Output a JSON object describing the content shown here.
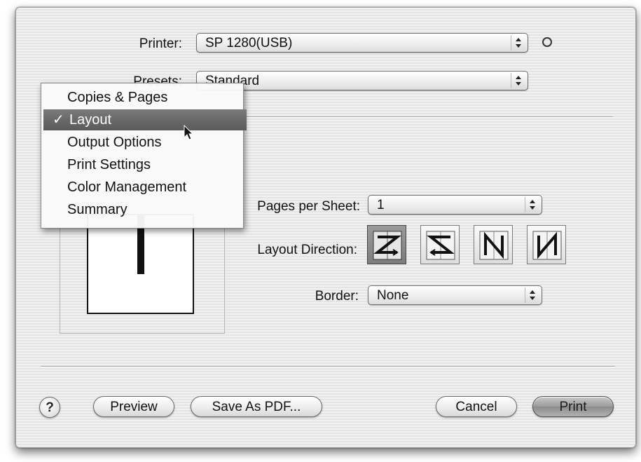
{
  "printer": {
    "label": "Printer:",
    "value": "SP 1280(USB)"
  },
  "presets": {
    "label": "Presets:",
    "value": "Standard"
  },
  "panel_menu": {
    "items": [
      {
        "label": "Copies & Pages",
        "selected": false
      },
      {
        "label": "Layout",
        "selected": true
      },
      {
        "label": "Output Options",
        "selected": false
      },
      {
        "label": "Print Settings",
        "selected": false
      },
      {
        "label": "Color Management",
        "selected": false
      },
      {
        "label": "Summary",
        "selected": false
      }
    ],
    "checkmark": "✓"
  },
  "layout": {
    "pages_per_sheet": {
      "label": "Pages per Sheet:",
      "value": "1"
    },
    "layout_direction": {
      "label": "Layout Direction:",
      "options": [
        "z-left-right",
        "s-left-right",
        "n-top-bottom",
        "n-top-bottom-reverse"
      ],
      "selected_index": 0
    },
    "border": {
      "label": "Border:",
      "value": "None"
    }
  },
  "buttons": {
    "help": "?",
    "preview": "Preview",
    "save_pdf": "Save As PDF...",
    "cancel": "Cancel",
    "print": "Print"
  },
  "colors": {
    "menu_highlight": "#666666",
    "print_button": "#9a9a9a"
  }
}
